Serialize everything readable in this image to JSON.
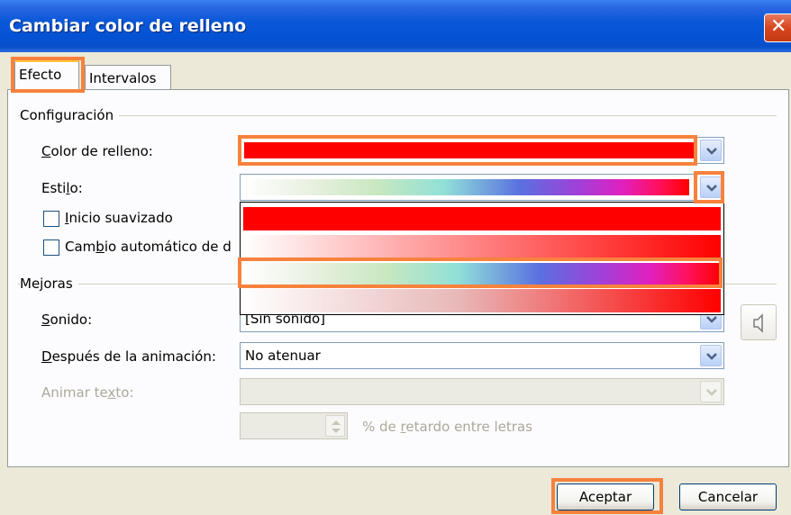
{
  "window": {
    "title": "Cambiar color de relleno",
    "close_glyph": "✕"
  },
  "tabs": [
    {
      "label": "Efecto",
      "active": true
    },
    {
      "label": "Intervalos",
      "active": false
    }
  ],
  "configuracion": {
    "group_label": "Configuración",
    "fill_color_label_pre": "C",
    "fill_color_label_rest": "olor de relleno:",
    "fill_color_value": "#FF0000",
    "style_label_pre": "Esti",
    "style_label_u": "l",
    "style_label_post": "o:",
    "smooth_start_pre": "I",
    "smooth_start_rest": "nicio suavizado",
    "auto_change_pre": "Cam",
    "auto_change_u": "b",
    "auto_change_post": "io automático de d"
  },
  "mejoras": {
    "group_label": "Mejoras",
    "sound_label_pre": "S",
    "sound_label_rest": "onido:",
    "sound_value": "[Sin sonido]",
    "after_anim_label_pre": "D",
    "after_anim_label_rest": "espués de la animación:",
    "after_anim_value": "No atenuar",
    "animate_text_label_pre": "Animar te",
    "animate_text_label_u": "x",
    "animate_text_label_post": "to:",
    "delay_label_pre": "% de ",
    "delay_label_u": "r",
    "delay_label_post": "etardo entre letras"
  },
  "style_options": [
    "solid-red",
    "white-to-red",
    "rainbow",
    "white-to-red-soft"
  ],
  "buttons": {
    "ok": "Aceptar",
    "cancel": "Cancelar"
  },
  "colors": {
    "highlight": "#F7823D",
    "fill": "#FF0000",
    "xp_blue": "#0453D4"
  }
}
